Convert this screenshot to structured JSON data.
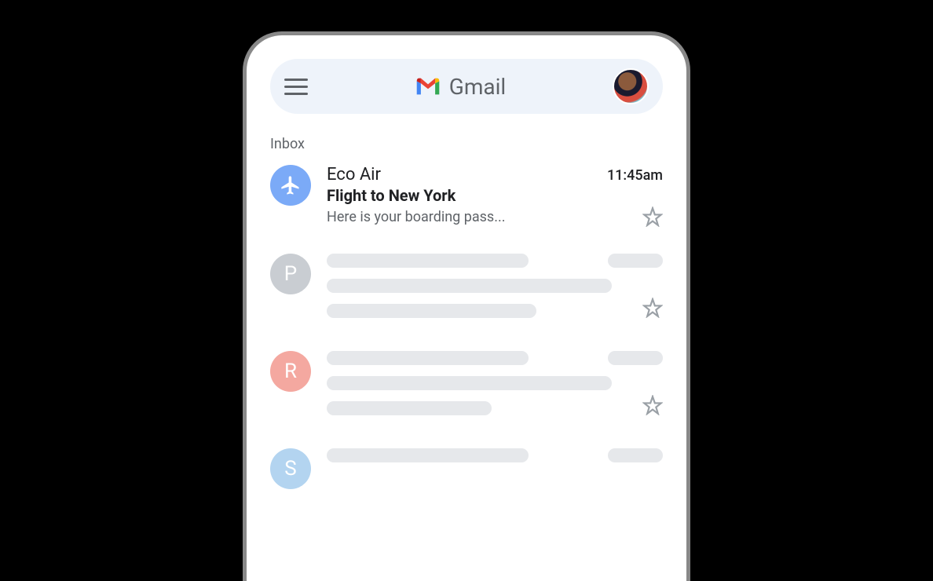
{
  "header": {
    "app_name": "Gmail"
  },
  "section": {
    "label": "Inbox"
  },
  "emails": [
    {
      "sender": "Eco Air",
      "time": "11:45am",
      "subject": "Flight to New York",
      "snippet": "Here is your boarding pass...",
      "avatar_type": "plane",
      "avatar_color": "blue"
    }
  ],
  "placeholders": [
    {
      "letter": "P",
      "color": "grey"
    },
    {
      "letter": "R",
      "color": "red"
    },
    {
      "letter": "S",
      "color": "lightblue"
    }
  ]
}
